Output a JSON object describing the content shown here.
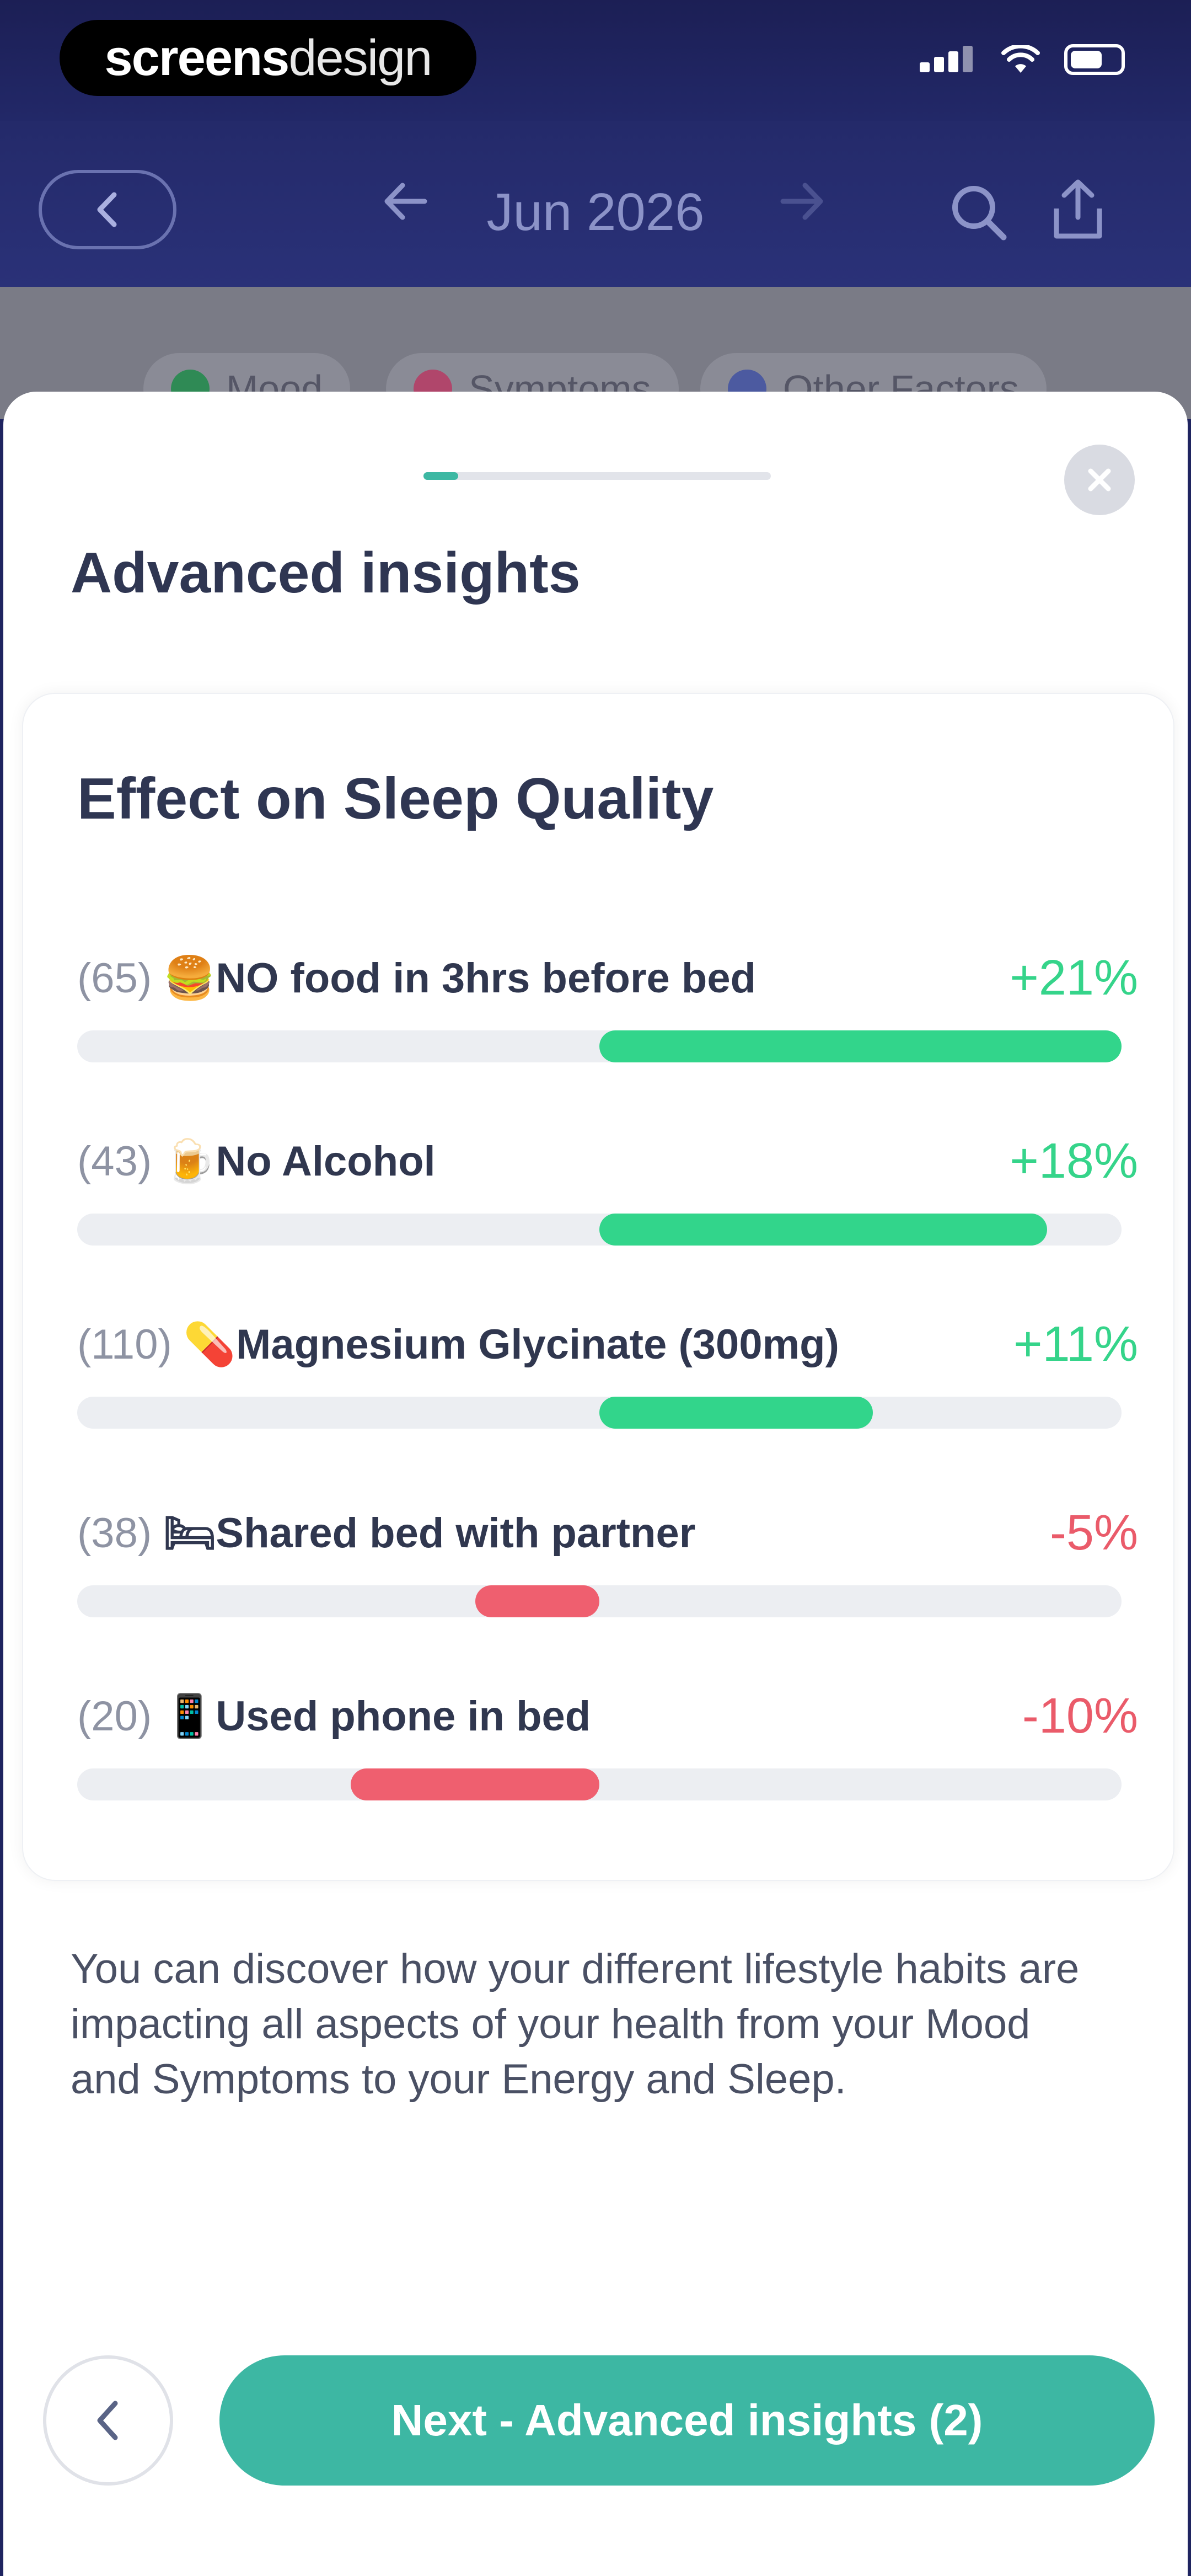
{
  "status_bar": {
    "brand_bold": "screens",
    "brand_thin": "design"
  },
  "nav": {
    "title": "Jun 2026",
    "back_icon": "chevron-left-icon",
    "prev_icon": "arrow-left-icon",
    "next_icon": "arrow-right-icon",
    "search_icon": "search-icon",
    "share_icon": "share-icon"
  },
  "filters": [
    {
      "label": "Mood",
      "color": "#2f8a55"
    },
    {
      "label": "Symptoms",
      "color": "#b0466b"
    },
    {
      "label": "Other Factors",
      "color": "#4c5aa0"
    }
  ],
  "sheet": {
    "title": "Advanced insights",
    "progress": 0.1,
    "close_icon": "close-icon"
  },
  "card": {
    "title": "Effect on Sleep Quality",
    "rows": [
      {
        "count": "(65)",
        "emoji": "🍔",
        "label": "NO food in 3hrs before bed",
        "pct": "+21%",
        "value": 21
      },
      {
        "count": "(43)",
        "emoji": "🍺",
        "label": "No Alcohol",
        "pct": "+18%",
        "value": 18
      },
      {
        "count": "(110)",
        "emoji": "💊",
        "label": "Magnesium Glycinate (300mg)",
        "pct": "+11%",
        "value": 11
      },
      {
        "count": "(38)",
        "emoji": "🛏",
        "label": "Shared bed with partner",
        "pct": "-5%",
        "value": -5
      },
      {
        "count": "(20)",
        "emoji": "📱",
        "label": "Used phone in bed",
        "pct": "-10%",
        "value": -10
      }
    ]
  },
  "description": "You can discover how your different lifestyle habits are impacting all aspects of your health from your Mood and Symptoms to your Energy and Sleep.",
  "footer": {
    "back_icon": "chevron-left-icon",
    "next_label": "Next - Advanced insights (2)"
  },
  "colors": {
    "accent": "#3db7a3",
    "positive": "#32d58b",
    "negative": "#ef5f6f"
  }
}
